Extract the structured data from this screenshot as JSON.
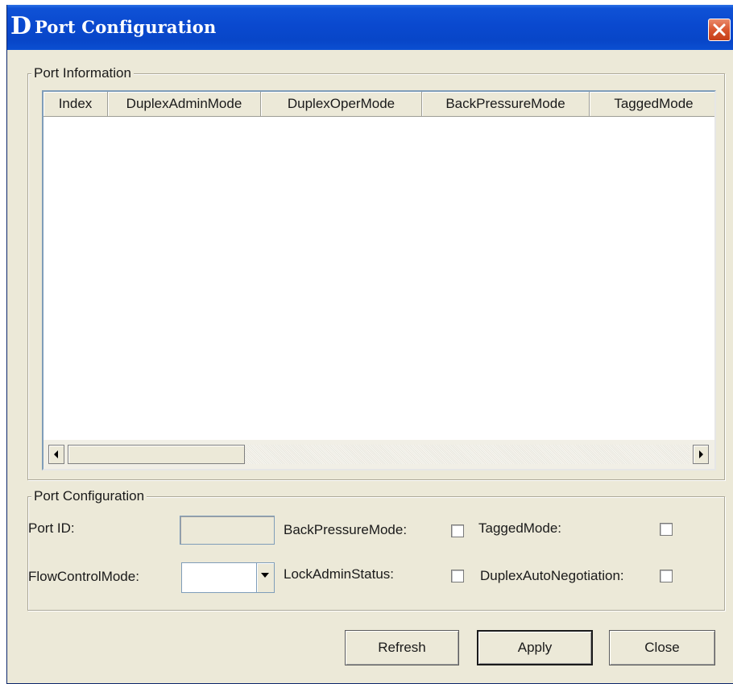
{
  "window": {
    "logo": "D",
    "title": "Port Configuration"
  },
  "port_information": {
    "group_label": "Port Information",
    "columns": [
      "Index",
      "DuplexAdminMode",
      "DuplexOperMode",
      "BackPressureMode",
      "TaggedMode"
    ],
    "rows": []
  },
  "port_configuration": {
    "group_label": "Port Configuration",
    "port_id_label": "Port ID:",
    "port_id_value": "",
    "flow_control_label": "FlowControlMode:",
    "flow_control_value": "",
    "back_pressure_label": "BackPressureMode:",
    "back_pressure_checked": false,
    "lock_admin_label": "LockAdminStatus:",
    "lock_admin_checked": false,
    "tagged_mode_label": "TaggedMode:",
    "tagged_mode_checked": false,
    "duplex_auto_label": "DuplexAutoNegotiation:",
    "duplex_auto_checked": false
  },
  "buttons": {
    "refresh": "Refresh",
    "apply": "Apply",
    "close": "Close"
  },
  "colors": {
    "title_bar": "#0a49cf",
    "close_button": "#d9562f",
    "window_background": "#ece9d8"
  }
}
